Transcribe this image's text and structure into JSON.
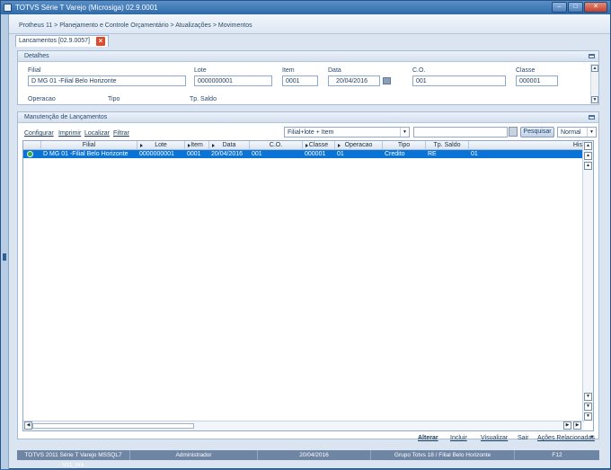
{
  "window": {
    "title": "TOTVS Série T Varejo (Microsiga) 02.9.0001"
  },
  "breadcrumb": "Protheus 11 > Planejamento e Controle Orçamentário > Atualizações > Movimentos",
  "tab": {
    "label": "Lancamentos [02.9.0057]"
  },
  "detalhes": {
    "title": "Detalhes",
    "fields": {
      "filial": {
        "label": "Filial",
        "value": "D MG 01 -Filial Belo Horizonte"
      },
      "lote": {
        "label": "Lote",
        "value": "0000000001"
      },
      "item": {
        "label": "Item",
        "value": "0001"
      },
      "data": {
        "label": "Data",
        "value": "20/04/2016"
      },
      "co": {
        "label": "C.O.",
        "value": "001"
      },
      "classe": {
        "label": "Classe",
        "value": "000001"
      },
      "operacao": {
        "label": "Operacao"
      },
      "tipo": {
        "label": "Tipo"
      },
      "tpsaldo": {
        "label": "Tp. Saldo"
      }
    }
  },
  "manutencao": {
    "title": "Manutenção de Lançamentos",
    "links": {
      "configurar": "Configurar",
      "imprimir": "Imprimir",
      "localizar": "Localizar",
      "filtrar": "Filtrar"
    },
    "index_select": "Filial+lote + Item",
    "search_button": "Pesquisar",
    "view_select": "Normal"
  },
  "grid": {
    "headers": {
      "filial": "Filial",
      "lote": "Lote",
      "item": "Item",
      "data": "Data",
      "co": "C.O.",
      "classe": "Classe",
      "operacao": "Operacao",
      "tipo": "Tipo",
      "tpsaldo": "Tp. Saldo",
      "hist": "His"
    },
    "row": {
      "filial": "D MG 01 -Filial Belo Horizonte",
      "lote": "0000000001",
      "item": "0001",
      "data": "20/04/2016",
      "co": "001",
      "classe": "000001",
      "operacao": "01",
      "tipo": "Credito",
      "tpsaldo": "RE",
      "hist": "01"
    }
  },
  "footer": {
    "alterar": "Alterar",
    "incluir": "Incluir",
    "visualizar": "Visualizar",
    "sair": "Sair",
    "acoes": "Ações Relacionadas"
  },
  "status": {
    "system": "TOTVS 2011 Série T Varejo MSSQL7 V11_bra",
    "user": "Administrador",
    "date": "20/04/2016",
    "group": "Grupo Totvs 18 / Filial Belo Horizonte",
    "key": "F12"
  },
  "colors": {
    "title_bar": "#2f6aa8",
    "selected_row": "#0a74d6",
    "status_ok": "#2fb22a",
    "close_tab": "#e0492c"
  }
}
